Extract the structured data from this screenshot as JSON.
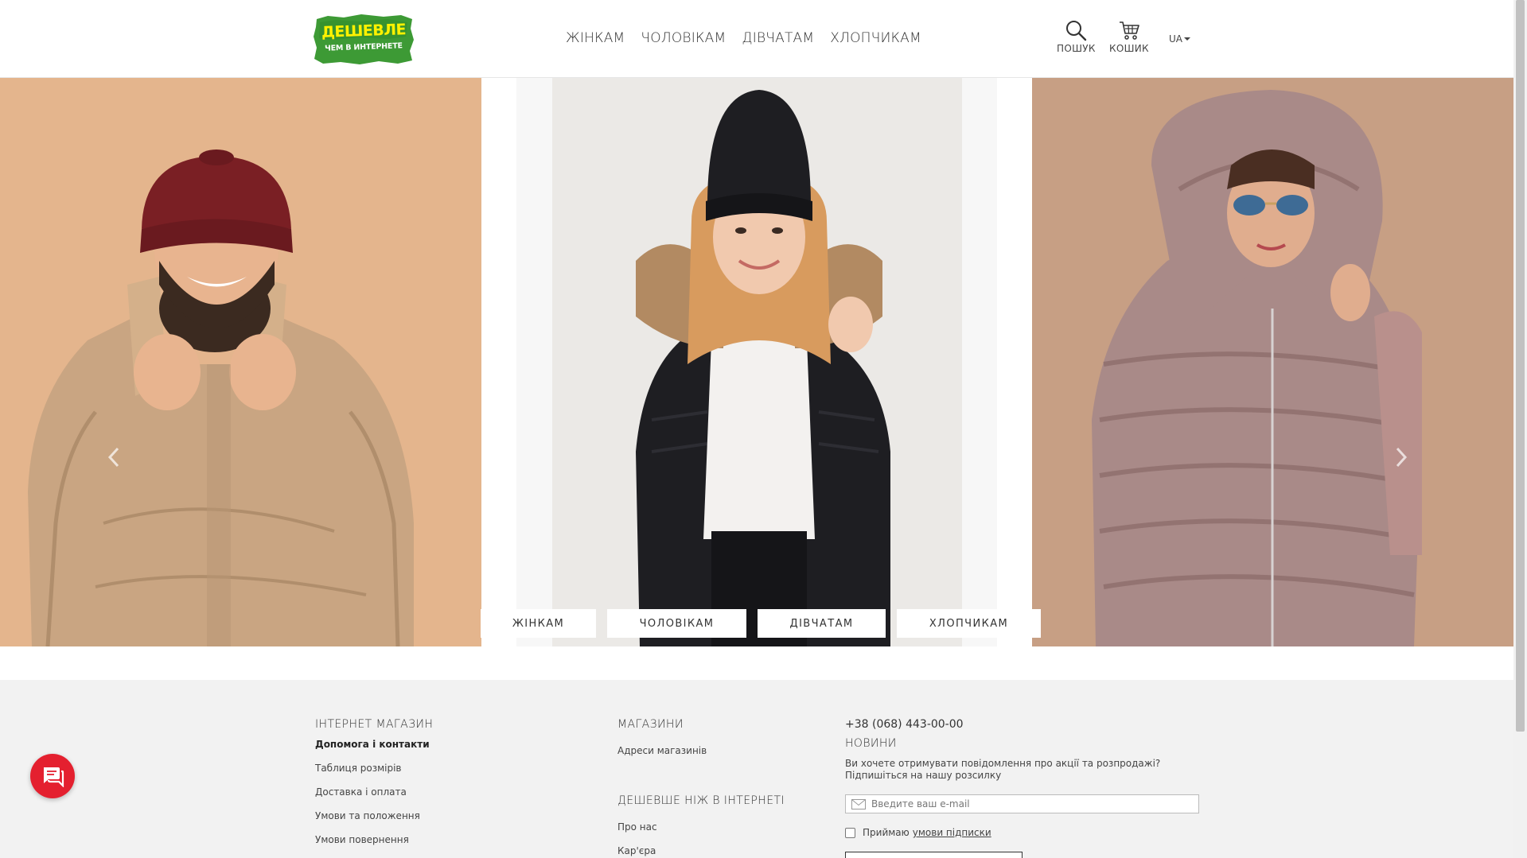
{
  "header": {
    "logo": {
      "line1": "ДЕШЕВЛЕ",
      "line2": "ЧЕМ В ИНТЕРНЕТЕ"
    },
    "nav": [
      "ЖІНКАМ",
      "ЧОЛОВІКАМ",
      "ДІВЧАТАМ",
      "ХЛОПЧИКАМ"
    ],
    "search_label": "ПОШУК",
    "cart_label": "КОШИК",
    "language": "UA"
  },
  "carousel": {
    "slides": [
      {
        "id": "men-beanie-puffer",
        "bg": "#e4b58d"
      },
      {
        "id": "woman-black-jacket-fur",
        "bg": "#e8e6e2"
      },
      {
        "id": "woman-fur-coat",
        "bg": "#c79f84"
      }
    ],
    "category_buttons": [
      "ЖІНКАМ",
      "ЧОЛОВІКАМ",
      "ДІВЧАТАМ",
      "ХЛОПЧИКАМ"
    ]
  },
  "footer": {
    "shop": {
      "title": "ІНТЕРНЕТ МАГАЗИН",
      "links": [
        "Допомога і контакти",
        "Таблиця розмірів",
        "Доставка і оплата",
        "Умови та положення",
        "Умови повернення"
      ]
    },
    "stores": {
      "title": "МАГАЗИНИ",
      "links": [
        "Адреси магазинів"
      ]
    },
    "about": {
      "title": "ДЕШЕВШЕ НІЖ В ІНТЕРНЕТІ",
      "links": [
        "Про нас",
        "Кар'єра"
      ]
    },
    "contact": {
      "phone": "+38 (068) 443-00-00",
      "news_title": "НОВИНИ",
      "news_text": "Ви хочете отримувати повідомлення про акції та розпродажі? Підпишіться на нашу розсилку",
      "email_placeholder": "Введите ваш e-mail",
      "consent_text": "Приймаю",
      "consent_link": "умови підписки"
    }
  },
  "colors": {
    "chat": "#e4202f",
    "logo_green": "#3d9a35",
    "logo_yellow": "#fff200",
    "footer_bg": "#f2f2f2"
  }
}
